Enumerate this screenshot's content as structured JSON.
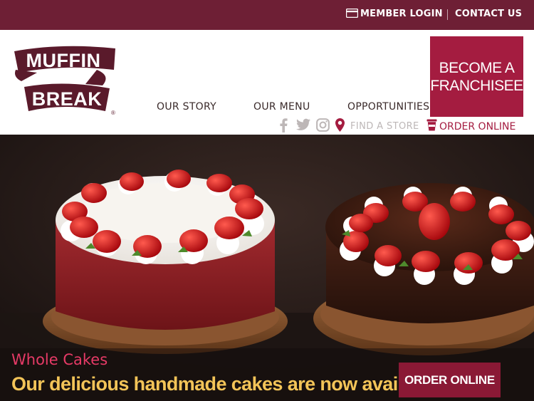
{
  "topbar": {
    "member_login": "MEMBER LOGIN",
    "contact_us": "CONTACT US"
  },
  "header": {
    "logo_text": [
      "MUFFIN",
      "BREAK"
    ],
    "logo_mark": "®",
    "nav": [
      {
        "label": "OUR STORY"
      },
      {
        "label": "OUR MENU"
      },
      {
        "label": "OPPORTUNITIES"
      }
    ],
    "franchise": {
      "line1": "BECOME A",
      "line2": "FRANCHISEE"
    },
    "social_icons": [
      "facebook-icon",
      "twitter-icon",
      "instagram-icon"
    ],
    "find_store": "FIND A STORE",
    "order_online": "ORDER ONLINE"
  },
  "hero": {
    "subtitle": "Whole Cakes",
    "title": "Our delicious handmade cakes are now available",
    "cta": "ORDER ONLINE"
  },
  "colors": {
    "brand_maroon": "#6e1f35",
    "brand_red": "#a41c40",
    "cta_red": "#8a1935",
    "headline_gold": "#f3c458",
    "subtitle_pink": "#e63a66"
  }
}
